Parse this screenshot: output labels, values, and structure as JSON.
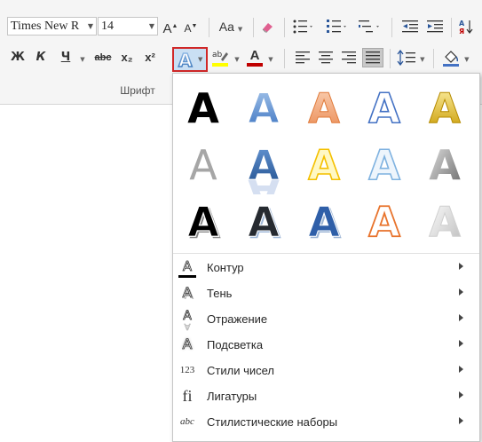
{
  "ribbon": {
    "font_name": "Times New R",
    "font_size": "14",
    "grow_label": "A",
    "shrink_label": "A",
    "case_label": "Aa",
    "bold_label": "Ж",
    "italic_label": "К",
    "underline_label": "Ч",
    "strike_label": "abc",
    "subscript_label": "x₂",
    "superscript_label": "x²",
    "highlight_label": "ab",
    "font_color_label": "A",
    "group_label": "Шрифт",
    "font_color_bar": "#c00000",
    "highlight_bar": "#ffff00",
    "text_effects_color": "#4472c4"
  },
  "gallery": {
    "styles": [
      "black-fill",
      "blue-gradient",
      "orange-gradient",
      "blue-outline",
      "gold-bevel",
      "gray-fill",
      "blue-reflection",
      "yellow-outline",
      "light-blue-outline",
      "gray-gradient",
      "black-shadow",
      "dark-shadow",
      "blue-shadow",
      "orange-outline",
      "light-gray"
    ],
    "glyph": "A"
  },
  "menu": {
    "items": [
      {
        "label": "Контур",
        "icon": "outline-icon"
      },
      {
        "label": "Тень",
        "icon": "shadow-icon"
      },
      {
        "label": "Отражение",
        "icon": "reflection-icon"
      },
      {
        "label": "Подсветка",
        "icon": "glow-icon"
      },
      {
        "label": "Стили чисел",
        "icon": "number-styles-icon"
      },
      {
        "label": "Лигатуры",
        "icon": "ligatures-icon"
      },
      {
        "label": "Стилистические наборы",
        "icon": "stylistic-sets-icon"
      }
    ],
    "icon_glyphs": [
      "A",
      "A",
      "A",
      "A",
      "123",
      "fi",
      "abc"
    ]
  }
}
